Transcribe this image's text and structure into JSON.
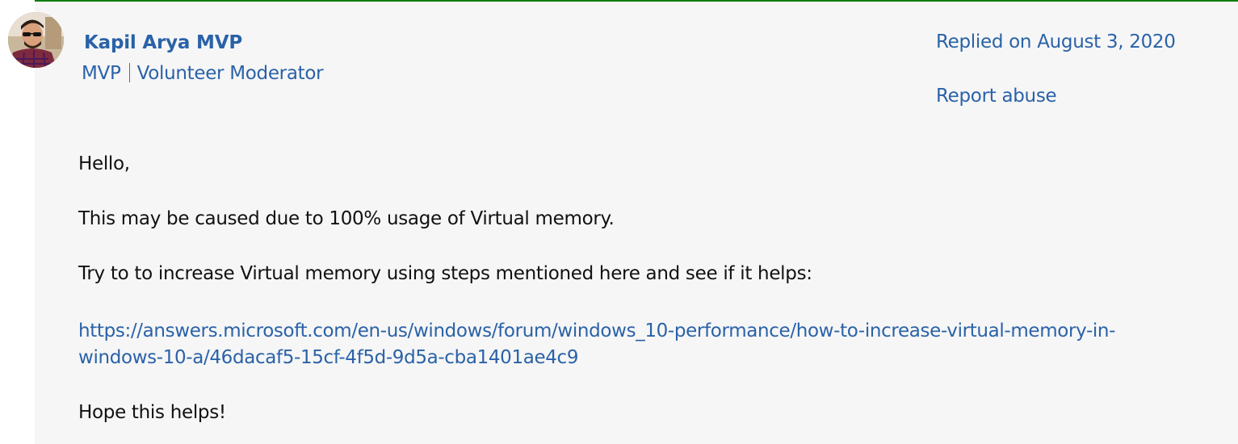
{
  "author": {
    "name": "Kapil Arya MVP",
    "roles": [
      "MVP",
      "Volunteer Moderator"
    ]
  },
  "meta": {
    "replied": "Replied on August 3, 2020",
    "report": "Report abuse"
  },
  "reply": {
    "greeting": "Hello,",
    "line1": "This may be caused due to 100% usage of Virtual memory.",
    "line2": "Try to to increase Virtual memory using steps mentioned here and see if it helps:",
    "link_part1": "https://answers.microsoft.com/en-us/windows/forum/windows_10-performance/how-to-increase-virtual-memory-in-",
    "link_part2": "windows-10-a/46dacaf5-15cf-4f5d-9d5a-cba1401ae4c9",
    "closing": "Hope this helps!"
  },
  "colors": {
    "link": "#2a62a8",
    "accent_border": "#107c10",
    "panel_bg": "#f6f6f6"
  }
}
